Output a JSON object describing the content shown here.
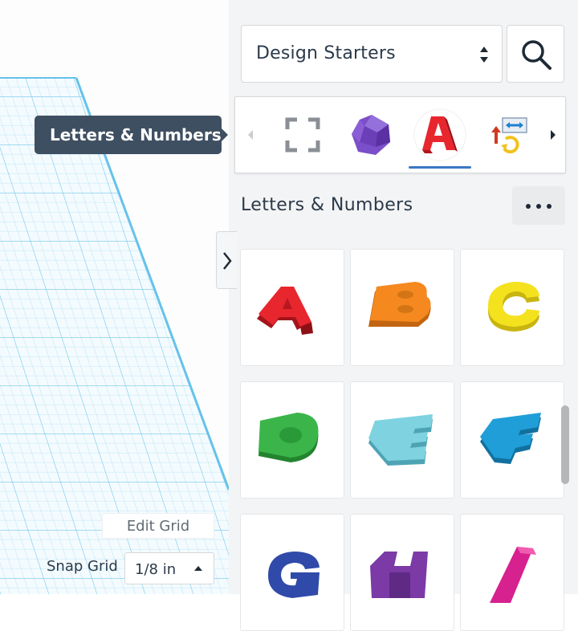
{
  "tooltip": {
    "text": "Letters & Numbers"
  },
  "shapes_panel": {
    "dropdown_value": "Design Starters",
    "categories": [
      {
        "name": "recent",
        "icon": "frame-icon"
      },
      {
        "name": "polyhedron",
        "icon": "polyhedron-icon"
      },
      {
        "name": "Letters & Numbers",
        "icon": "letter-a-icon",
        "selected": true
      },
      {
        "name": "connectors",
        "icon": "connector-icon"
      }
    ],
    "section_title": "Letters & Numbers",
    "tiles": [
      {
        "letter": "A",
        "color": "#e8262e"
      },
      {
        "letter": "B",
        "color": "#f5891f"
      },
      {
        "letter": "C",
        "color": "#f4e21f"
      },
      {
        "letter": "D",
        "color": "#3bb54a"
      },
      {
        "letter": "E",
        "color": "#7fd3e0"
      },
      {
        "letter": "F",
        "color": "#1f9ed8"
      },
      {
        "letter": "G",
        "color": "#2f4aa8"
      },
      {
        "letter": "H",
        "color": "#7b3aa6"
      },
      {
        "letter": "I",
        "color": "#d6218e"
      }
    ]
  },
  "grid_controls": {
    "edit_grid_label": "Edit Grid",
    "snap_grid_label": "Snap Grid",
    "snap_value": "1/8 in"
  },
  "colors": {
    "accent": "#3a78c2",
    "tooltip_bg": "#3f4f62",
    "grid_line": "#7fd0ee"
  }
}
